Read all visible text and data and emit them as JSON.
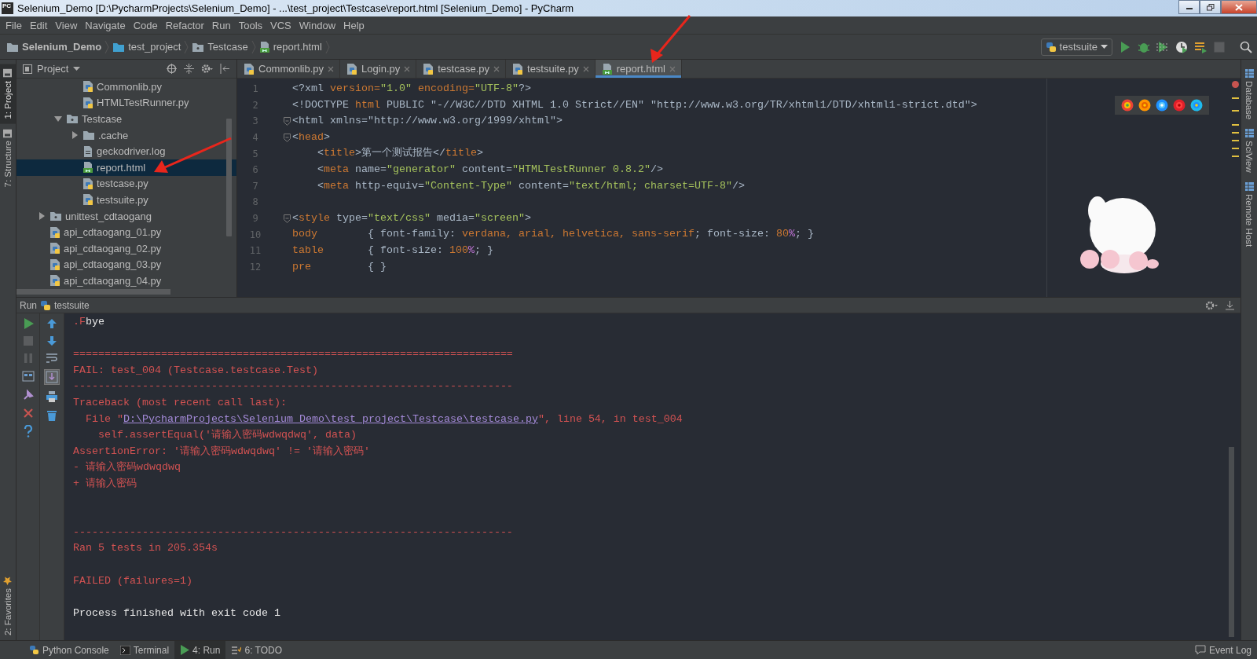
{
  "window": {
    "title": "Selenium_Demo [D:\\PycharmProjects\\Selenium_Demo] - ...\\test_project\\Testcase\\report.html [Selenium_Demo] - PyCharm",
    "app_badge": "PC"
  },
  "menu": [
    "File",
    "Edit",
    "View",
    "Navigate",
    "Code",
    "Refactor",
    "Run",
    "Tools",
    "VCS",
    "Window",
    "Help"
  ],
  "breadcrumbs": [
    {
      "label": "Selenium_Demo",
      "kind": "root"
    },
    {
      "label": "test_project",
      "kind": "folder"
    },
    {
      "label": "Testcase",
      "kind": "package"
    },
    {
      "label": "report.html",
      "kind": "html"
    }
  ],
  "run_config": {
    "label": "testsuite"
  },
  "toolbar": [
    {
      "kind": "run",
      "disabled": false
    },
    {
      "kind": "debug",
      "disabled": false
    },
    {
      "kind": "coverage",
      "disabled": false
    },
    {
      "kind": "profile",
      "disabled": false
    },
    {
      "kind": "concurrency",
      "disabled": false
    },
    {
      "kind": "stop",
      "disabled": true
    },
    {
      "kind": "search",
      "disabled": false
    }
  ],
  "left_strip": {
    "top": [
      {
        "label": "1: Project",
        "selected": true
      },
      {
        "label": "7: Structure",
        "selected": false
      }
    ],
    "bottom": [
      {
        "label": "2: Favorites",
        "selected": false
      }
    ]
  },
  "right_strip": [
    {
      "label": "Database"
    },
    {
      "label": "SciView"
    },
    {
      "label": "Remote Host"
    }
  ],
  "project": {
    "title": "Project",
    "tree": [
      {
        "children": [
          {
            "children": [
              {
                "label": "Commonlib.py",
                "kind": "py",
                "selected": false
              },
              {
                "label": "HTMLTestRunner.py",
                "kind": "py",
                "selected": false
              }
            ]
          },
          {
            "label": "Testcase",
            "kind": "package",
            "expanded": true,
            "selected": false,
            "children": [
              {
                "label": ".cache",
                "kind": "folder",
                "expanded": false,
                "selected": false
              },
              {
                "label": "geckodriver.log",
                "kind": "log",
                "selected": false
              },
              {
                "label": "report.html",
                "kind": "html",
                "selected": true
              },
              {
                "label": "testcase.py",
                "kind": "py",
                "selected": false
              },
              {
                "label": "testsuite.py",
                "kind": "py",
                "selected": false
              }
            ]
          }
        ]
      },
      {
        "label": "unittest_cdtaogang",
        "kind": "package",
        "expanded": false,
        "selected": false
      },
      {
        "label": "api_cdtaogang_01.py",
        "kind": "py",
        "selected": false
      },
      {
        "label": "api_cdtaogang_02.py",
        "kind": "py",
        "selected": false
      },
      {
        "label": "api_cdtaogang_03.py",
        "kind": "py",
        "selected": false
      },
      {
        "label": "api_cdtaogang_04.py",
        "kind": "py",
        "selected": false
      }
    ]
  },
  "editor_tabs": [
    {
      "label": "Commonlib.py",
      "kind": "py",
      "selected": false
    },
    {
      "label": "Login.py",
      "kind": "py",
      "selected": false
    },
    {
      "label": "testcase.py",
      "kind": "py",
      "selected": false
    },
    {
      "label": "testsuite.py",
      "kind": "py",
      "selected": false
    },
    {
      "label": "report.html",
      "kind": "html",
      "selected": true
    }
  ],
  "code": [
    {
      "number": "1",
      "fold": false,
      "tokens": [
        {
          "kind": "plain",
          "text": "<?xml "
        },
        {
          "kind": "attr",
          "text": "version="
        },
        {
          "kind": "str",
          "text": "\"1.0\""
        },
        {
          "kind": "attr",
          "text": " encoding="
        },
        {
          "kind": "str",
          "text": "\"UTF-8\""
        },
        {
          "kind": "plain",
          "text": "?>"
        }
      ]
    },
    {
      "number": "2",
      "fold": false,
      "tokens": [
        {
          "kind": "plain",
          "text": "<!DOCTYPE "
        },
        {
          "kind": "tag",
          "text": "html"
        },
        {
          "kind": "plain",
          "text": " PUBLIC \"-//W3C//DTD XHTML 1.0 Strict//EN\" \"http://www.w3.org/TR/xhtml1/DTD/xhtml1-strict.dtd\">"
        }
      ]
    },
    {
      "number": "3",
      "fold": true,
      "tokens": [
        {
          "kind": "plain",
          "text": "<html xmlns=\"http://www.w3.org/1999/xhtml\">"
        }
      ]
    },
    {
      "number": "4",
      "fold": true,
      "tokens": [
        {
          "kind": "plain",
          "text": "<"
        },
        {
          "kind": "tag",
          "text": "head"
        },
        {
          "kind": "plain",
          "text": ">"
        }
      ]
    },
    {
      "number": "5",
      "fold": false,
      "tokens": [
        {
          "kind": "plain",
          "text": "    <"
        },
        {
          "kind": "tag",
          "text": "title"
        },
        {
          "kind": "plain",
          "text": ">第一个测试报告</"
        },
        {
          "kind": "tag",
          "text": "title"
        },
        {
          "kind": "plain",
          "text": ">"
        }
      ]
    },
    {
      "number": "6",
      "fold": false,
      "tokens": [
        {
          "kind": "plain",
          "text": "    <"
        },
        {
          "kind": "tag",
          "text": "meta"
        },
        {
          "kind": "plain",
          "text": " name="
        },
        {
          "kind": "str",
          "text": "\"generator\""
        },
        {
          "kind": "plain",
          "text": " content="
        },
        {
          "kind": "str",
          "text": "\"HTMLTestRunner 0.8.2\""
        },
        {
          "kind": "plain",
          "text": "/>"
        }
      ]
    },
    {
      "number": "7",
      "fold": false,
      "tokens": [
        {
          "kind": "plain",
          "text": "    <"
        },
        {
          "kind": "tag",
          "text": "meta"
        },
        {
          "kind": "plain",
          "text": " http-equiv="
        },
        {
          "kind": "str",
          "text": "\"Content-Type\""
        },
        {
          "kind": "plain",
          "text": " content="
        },
        {
          "kind": "str",
          "text": "\"text/html; charset=UTF-8\""
        },
        {
          "kind": "plain",
          "text": "/>"
        }
      ]
    },
    {
      "number": "8",
      "fold": false
    },
    {
      "number": "9",
      "fold": true,
      "tokens": [
        {
          "kind": "plain",
          "text": "<"
        },
        {
          "kind": "tag",
          "text": "style"
        },
        {
          "kind": "plain",
          "text": " type="
        },
        {
          "kind": "str",
          "text": "\"text/css\""
        },
        {
          "kind": "plain",
          "text": " media="
        },
        {
          "kind": "str",
          "text": "\"screen\""
        },
        {
          "kind": "plain",
          "text": ">"
        }
      ]
    },
    {
      "number": "10",
      "fold": false,
      "tokens": [
        {
          "kind": "tag",
          "text": "body"
        },
        {
          "kind": "plain",
          "text": "        { font-family: "
        },
        {
          "kind": "value",
          "text": "verdana, arial, helvetica, sans-serif"
        },
        {
          "kind": "plain",
          "text": "; font-size: "
        },
        {
          "kind": "value",
          "text": "80"
        },
        {
          "kind": "unit",
          "text": "%"
        },
        {
          "kind": "plain",
          "text": "; }"
        }
      ]
    },
    {
      "number": "11",
      "fold": false,
      "tokens": [
        {
          "kind": "tag",
          "text": "table"
        },
        {
          "kind": "plain",
          "text": "       { font-size: "
        },
        {
          "kind": "value",
          "text": "100"
        },
        {
          "kind": "unit",
          "text": "%"
        },
        {
          "kind": "plain",
          "text": "; }"
        }
      ]
    },
    {
      "number": "12",
      "fold": false,
      "tokens": [
        {
          "kind": "tag",
          "text": "pre"
        },
        {
          "kind": "plain",
          "text": "         { }"
        }
      ]
    }
  ],
  "run": {
    "title": "Run",
    "config": "testsuite",
    "console": [
      {
        "kind": "text",
        "segments": [
          {
            "kind": "error",
            "text": ".F"
          },
          {
            "kind": "output",
            "text": "bye"
          }
        ]
      },
      {
        "kind": "blank"
      },
      {
        "kind": "text",
        "segments": [
          {
            "kind": "error",
            "text": "======================================================================"
          }
        ]
      },
      {
        "kind": "text",
        "segments": [
          {
            "kind": "error",
            "text": "FAIL: test_004 (Testcase.testcase.Test)"
          }
        ]
      },
      {
        "kind": "text",
        "segments": [
          {
            "kind": "error",
            "text": "----------------------------------------------------------------------"
          }
        ]
      },
      {
        "kind": "text",
        "segments": [
          {
            "kind": "error",
            "text": "Traceback (most recent call last):"
          }
        ]
      },
      {
        "kind": "text",
        "segments": [
          {
            "kind": "error",
            "text": "  File \""
          },
          {
            "kind": "link",
            "text": "D:\\PycharmProjects\\Selenium_Demo\\test_project\\Testcase\\testcase.py"
          },
          {
            "kind": "error",
            "text": "\", line 54, in test_004"
          }
        ]
      },
      {
        "kind": "text",
        "segments": [
          {
            "kind": "error",
            "text": "    self.assertEqual('请输入密码wdwqdwq', data)"
          }
        ]
      },
      {
        "kind": "text",
        "segments": [
          {
            "kind": "error",
            "text": "AssertionError: '请输入密码wdwqdwq' != '请输入密码'"
          }
        ]
      },
      {
        "kind": "text",
        "segments": [
          {
            "kind": "error",
            "text": "- 请输入密码wdwqdwq"
          }
        ]
      },
      {
        "kind": "text",
        "segments": [
          {
            "kind": "error",
            "text": "+ 请输入密码"
          }
        ]
      },
      {
        "kind": "blank"
      },
      {
        "kind": "blank"
      },
      {
        "kind": "text",
        "segments": [
          {
            "kind": "error",
            "text": "----------------------------------------------------------------------"
          }
        ]
      },
      {
        "kind": "text",
        "segments": [
          {
            "kind": "error",
            "text": "Ran 5 tests in 205.354s"
          }
        ]
      },
      {
        "kind": "blank"
      },
      {
        "kind": "text",
        "segments": [
          {
            "kind": "error",
            "text": "FAILED (failures=1)"
          }
        ]
      },
      {
        "kind": "blank"
      },
      {
        "kind": "text",
        "segments": [
          {
            "kind": "output",
            "text": "Process finished with exit code 1"
          }
        ]
      }
    ]
  },
  "bottom_tabs": {
    "left": [
      {
        "label": "Python Console",
        "kind": "python",
        "selected": false
      },
      {
        "label": "Terminal",
        "kind": "terminal",
        "selected": false
      },
      {
        "label": "4: Run",
        "kind": "run",
        "selected": true
      },
      {
        "label": "6: TODO",
        "kind": "todo",
        "selected": false
      }
    ],
    "right": [
      {
        "label": "Event Log",
        "kind": "event",
        "selected": false
      }
    ]
  }
}
